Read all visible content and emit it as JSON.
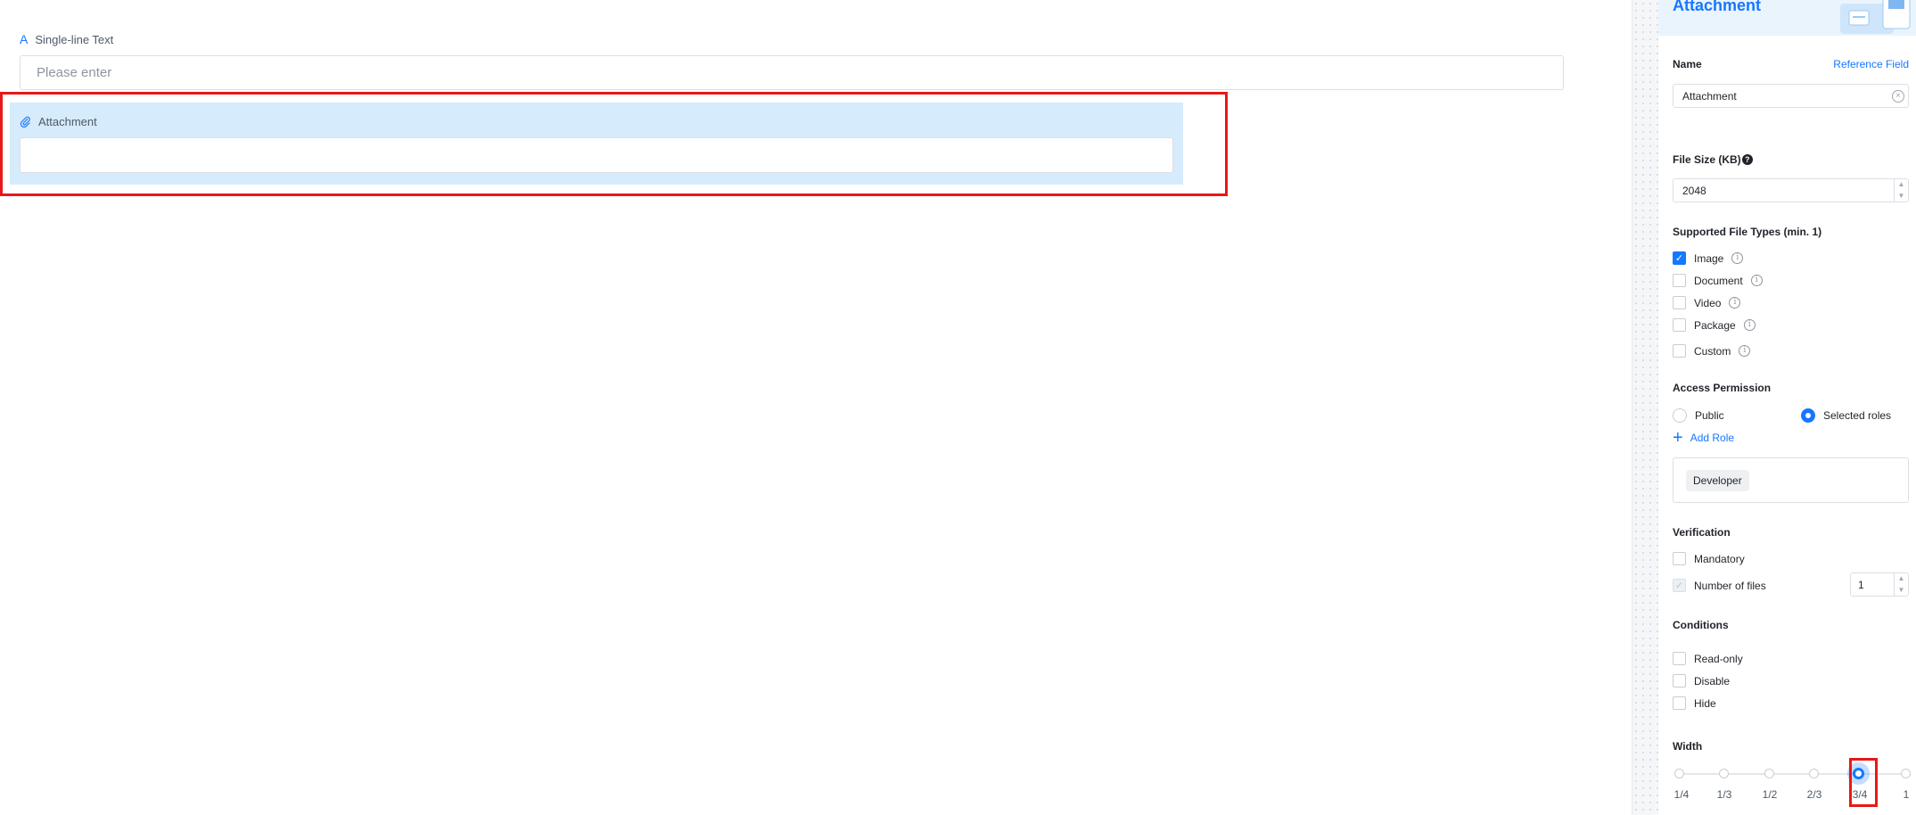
{
  "form": {
    "single_line": {
      "label": "Single-line Text",
      "placeholder": "Please enter"
    },
    "attachment": {
      "label": "Attachment"
    }
  },
  "panel": {
    "title": "Attachment",
    "name_label": "Name",
    "reference_field": "Reference Field",
    "name_value": "Attachment",
    "file_size_label": "File Size (KB)",
    "file_size_value": "2048",
    "file_types_label": "Supported File Types (min. 1)",
    "file_types": [
      {
        "label": "Image",
        "checked": true
      },
      {
        "label": "Document",
        "checked": false
      },
      {
        "label": "Video",
        "checked": false
      },
      {
        "label": "Package",
        "checked": false
      },
      {
        "label": "Custom",
        "checked": false
      }
    ],
    "access_label": "Access Permission",
    "access_options": [
      {
        "label": "Public",
        "selected": false
      },
      {
        "label": "Selected roles",
        "selected": true
      }
    ],
    "add_role": "Add Role",
    "roles": [
      "Developer"
    ],
    "verification_label": "Verification",
    "verification": [
      {
        "label": "Mandatory",
        "checked": false
      },
      {
        "label": "Number of files",
        "checked": true,
        "disabled": true
      }
    ],
    "number_of_files": "1",
    "conditions_label": "Conditions",
    "conditions": [
      {
        "label": "Read-only",
        "checked": false
      },
      {
        "label": "Disable",
        "checked": false
      },
      {
        "label": "Hide",
        "checked": false
      }
    ],
    "width_label": "Width",
    "width_options": [
      "1/4",
      "1/3",
      "1/2",
      "2/3",
      "3/4",
      "1"
    ],
    "width_selected": "3/4"
  },
  "colors": {
    "accent": "#1677ff",
    "highlight": "#e81818",
    "selected_bg": "#d6ebfb"
  },
  "icons": [
    "text-a-icon",
    "paperclip-icon",
    "clear-icon",
    "help-icon",
    "info-icon",
    "plus-icon"
  ]
}
